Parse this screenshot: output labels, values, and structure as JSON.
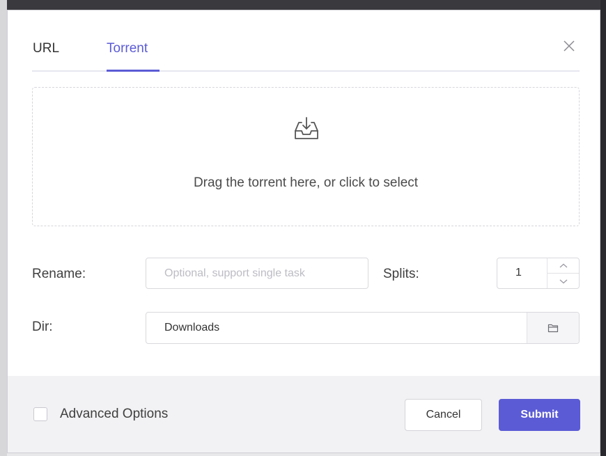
{
  "tabs": [
    {
      "label": "URL",
      "active": false
    },
    {
      "label": "Torrent",
      "active": true
    }
  ],
  "icons": {
    "close": "close-icon",
    "dropzone": "inbox-download-icon",
    "folder": "folder-icon",
    "step_up": "chevron-up-icon",
    "step_down": "chevron-down-icon"
  },
  "dropzone": {
    "text": "Drag the torrent here, or click to select"
  },
  "form": {
    "rename_label": "Rename:",
    "rename_placeholder": "Optional, support single task",
    "splits_label": "Splits:",
    "splits_value": "1",
    "dir_label": "Dir:",
    "dir_value": "Downloads"
  },
  "footer": {
    "advanced_options_label": "Advanced Options",
    "advanced_options_checked": false,
    "cancel_label": "Cancel",
    "submit_label": "Submit"
  },
  "colors": {
    "accent": "#5b5bd6",
    "footer_bg": "#f2f2f4"
  }
}
